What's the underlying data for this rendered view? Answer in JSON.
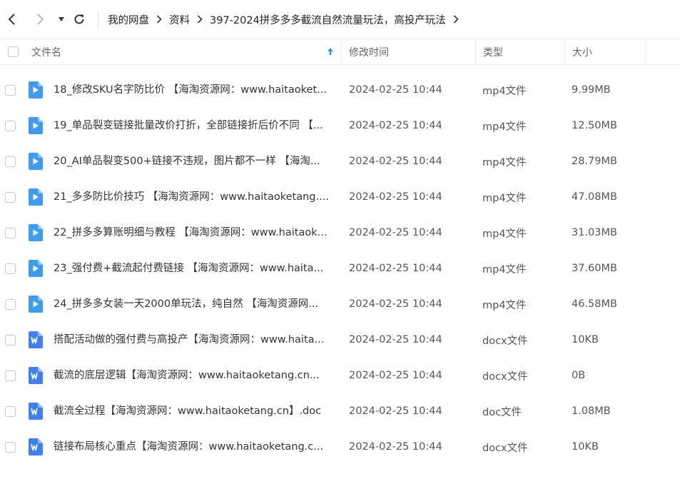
{
  "nav": {
    "breadcrumb": [
      "我的网盘",
      "资料",
      "397-2024拼多多多截流自然流量玩法，高投产玩法"
    ]
  },
  "header": {
    "name": "文件名",
    "modified": "修改时间",
    "type": "类型",
    "size": "大小"
  },
  "colors": {
    "video_icon": "#3d9bf0",
    "doc_icon": "#3f7ff3",
    "sort_arrow": "#3d8df0"
  },
  "files": [
    {
      "name": "18_修改SKU名字防比价 【海淘资源网：www.haitaoket...",
      "modified": "2024-02-25 10:44",
      "type": "mp4文件",
      "size": "9.99MB",
      "icon": "video-file-icon"
    },
    {
      "name": "19_单品裂变链接批量改价打折，全部链接折后价不同 【...",
      "modified": "2024-02-25 10:44",
      "type": "mp4文件",
      "size": "12.50MB",
      "icon": "video-file-icon"
    },
    {
      "name": "20_AI单品裂变500+链接不违规，图片都不一样 【海淘...",
      "modified": "2024-02-25 10:44",
      "type": "mp4文件",
      "size": "28.79MB",
      "icon": "video-file-icon"
    },
    {
      "name": "21_多多防比价技巧 【海淘资源网：www.haitaoketang....",
      "modified": "2024-02-25 10:44",
      "type": "mp4文件",
      "size": "47.08MB",
      "icon": "video-file-icon"
    },
    {
      "name": "22_拼多多算账明细与教程 【海淘资源网：www.haitaok...",
      "modified": "2024-02-25 10:44",
      "type": "mp4文件",
      "size": "31.03MB",
      "icon": "video-file-icon"
    },
    {
      "name": "23_强付费+截流起付费链接 【海淘资源网：www.haita...",
      "modified": "2024-02-25 10:44",
      "type": "mp4文件",
      "size": "37.60MB",
      "icon": "video-file-icon"
    },
    {
      "name": "24_拼多多女装一天2000单玩法，纯自然 【海淘资源网...",
      "modified": "2024-02-25 10:44",
      "type": "mp4文件",
      "size": "46.58MB",
      "icon": "video-file-icon"
    },
    {
      "name": "搭配活动做的强付费与高投产【海淘资源网：www.haita...",
      "modified": "2024-02-25 10:44",
      "type": "docx文件",
      "size": "10KB",
      "icon": "word-file-icon"
    },
    {
      "name": "截流的底层逻辑【海淘资源网：www.haitaoketang.cn...",
      "modified": "2024-02-25 10:44",
      "type": "docx文件",
      "size": "0B",
      "icon": "word-file-icon"
    },
    {
      "name": "截流全过程【海淘资源网：www.haitaoketang.cn】.doc",
      "modified": "2024-02-25 10:44",
      "type": "doc文件",
      "size": "1.08MB",
      "icon": "word-file-icon"
    },
    {
      "name": "链接布局核心重点【海淘资源网：www.haitaoketang.c...",
      "modified": "2024-02-25 10:44",
      "type": "docx文件",
      "size": "10KB",
      "icon": "word-file-icon"
    }
  ]
}
